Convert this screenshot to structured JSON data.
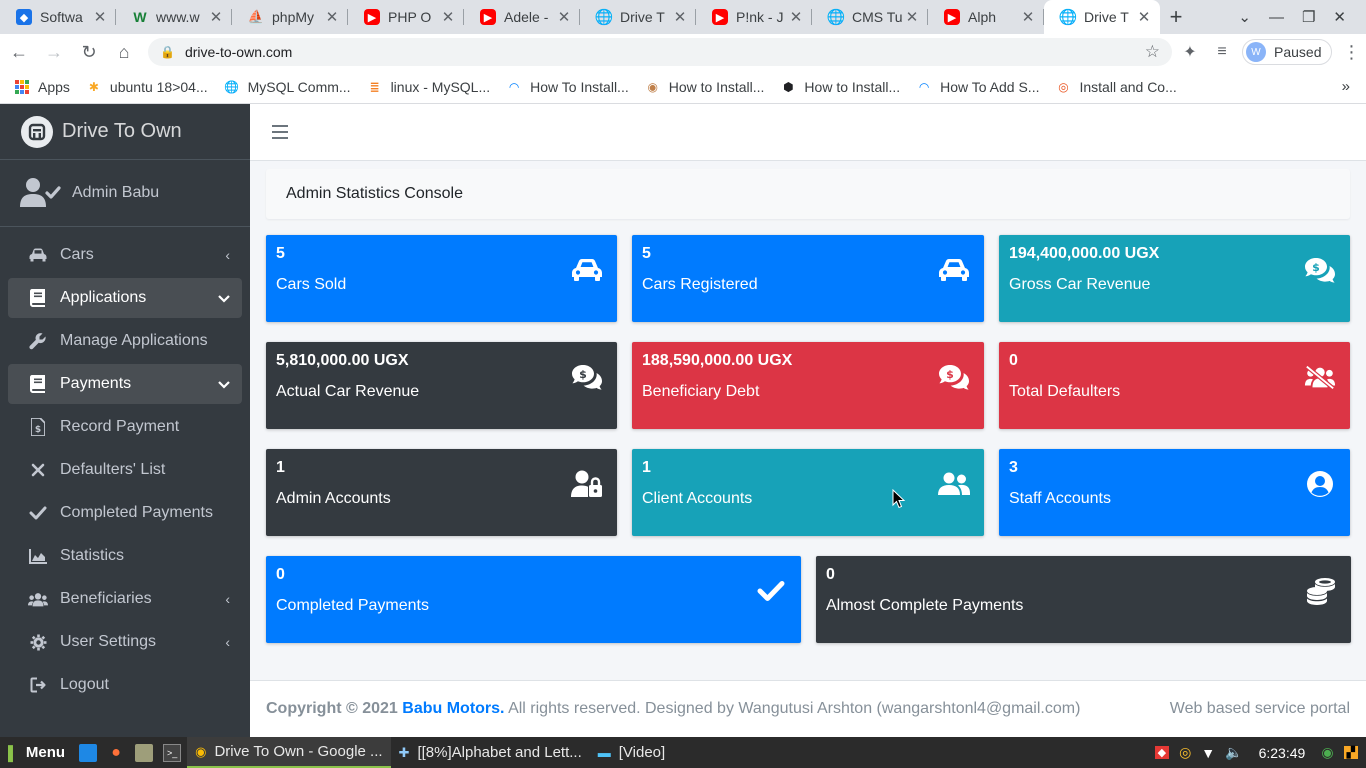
{
  "browser": {
    "tabs": [
      {
        "title": "Softwa",
        "icon": "microsoft-icon"
      },
      {
        "title": "www.w",
        "icon": "w-icon"
      },
      {
        "title": "phpMy",
        "icon": "phpmyadmin-icon"
      },
      {
        "title": "PHP O",
        "icon": "youtube-icon"
      },
      {
        "title": "Adele -",
        "icon": "youtube-icon"
      },
      {
        "title": "Drive T",
        "icon": "globe-icon"
      },
      {
        "title": "P!nk - J",
        "icon": "youtube-icon"
      },
      {
        "title": "CMS Tu",
        "icon": "globe-icon"
      },
      {
        "title": "Alph",
        "icon": "youtube-icon"
      },
      {
        "title": "Drive T",
        "icon": "globe-icon",
        "active": true
      }
    ],
    "url": "drive-to-own.com",
    "profile_initial": "W",
    "profile_status": "Paused",
    "bookmarks": [
      {
        "label": "Apps"
      },
      {
        "label": "ubuntu 18>04..."
      },
      {
        "label": "MySQL Comm..."
      },
      {
        "label": "linux - MySQL..."
      },
      {
        "label": "How To Install..."
      },
      {
        "label": "How to Install..."
      },
      {
        "label": "How to Install..."
      },
      {
        "label": "How To Add S..."
      },
      {
        "label": "Install and Co..."
      }
    ]
  },
  "sidebar": {
    "brand": "Drive To Own",
    "user": "Admin Babu",
    "items": [
      {
        "label": "Cars",
        "icon": "car-icon",
        "arrow": "left"
      },
      {
        "label": "Applications",
        "icon": "book-icon",
        "arrow": "down",
        "open": true
      },
      {
        "label": "Manage Applications",
        "icon": "wrench-icon"
      },
      {
        "label": "Payments",
        "icon": "book-icon",
        "arrow": "down",
        "open": true
      },
      {
        "label": "Record Payment",
        "icon": "file-invoice-icon"
      },
      {
        "label": "Defaulters' List",
        "icon": "times-icon"
      },
      {
        "label": "Completed Payments",
        "icon": "check-icon"
      },
      {
        "label": "Statistics",
        "icon": "chart-area-icon"
      },
      {
        "label": "Beneficiaries",
        "icon": "users-icon",
        "arrow": "left"
      },
      {
        "label": "User Settings",
        "icon": "gear-icon",
        "arrow": "left"
      },
      {
        "label": "Logout",
        "icon": "sign-out-icon"
      }
    ]
  },
  "main": {
    "console_title": "Admin Statistics Console",
    "cards": [
      {
        "value": "5",
        "label": "Cars Sold",
        "icon": "car-icon",
        "color": "#007bff"
      },
      {
        "value": "5",
        "label": "Cars Registered",
        "icon": "car-icon",
        "color": "#007bff"
      },
      {
        "value": "194,400,000.00 UGX",
        "label": "Gross Car Revenue",
        "icon": "comments-dollar-icon",
        "color": "#17a2b8"
      },
      {
        "value": "5,810,000.00 UGX",
        "label": "Actual Car Revenue",
        "icon": "comments-dollar-icon",
        "color": "#343a40"
      },
      {
        "value": "188,590,000.00 UGX",
        "label": "Beneficiary Debt",
        "icon": "comments-dollar-icon",
        "color": "#dc3545"
      },
      {
        "value": "0",
        "label": "Total Defaulters",
        "icon": "users-slash-icon",
        "color": "#dc3545"
      },
      {
        "value": "1",
        "label": "Admin Accounts",
        "icon": "user-lock-icon",
        "color": "#343a40"
      },
      {
        "value": "1",
        "label": "Client Accounts",
        "icon": "user-friends-icon",
        "color": "#17a2b8"
      },
      {
        "value": "3",
        "label": "Staff Accounts",
        "icon": "user-circle-icon",
        "color": "#007bff"
      },
      {
        "value": "0",
        "label": "Completed Payments",
        "icon": "check-icon",
        "color": "#007bff"
      },
      {
        "value": "0",
        "label": "Almost Complete Payments",
        "icon": "coins-icon",
        "color": "#343a40"
      }
    ]
  },
  "footer": {
    "copyright": "Copyright © 2021",
    "company": "Babu Motors.",
    "rights": "All rights reserved. Designed by Wangutusi Arshton (wangarshtonl4@gmail.com)",
    "right_text": "Web based service portal"
  },
  "taskbar": {
    "menu_label": "Menu",
    "windows": [
      {
        "label": "Drive To Own - Google ...",
        "active": true
      },
      {
        "label": "[[8%]Alphabet and Lett..."
      },
      {
        "label": "[Video]"
      }
    ],
    "clock": "6:23:49"
  }
}
